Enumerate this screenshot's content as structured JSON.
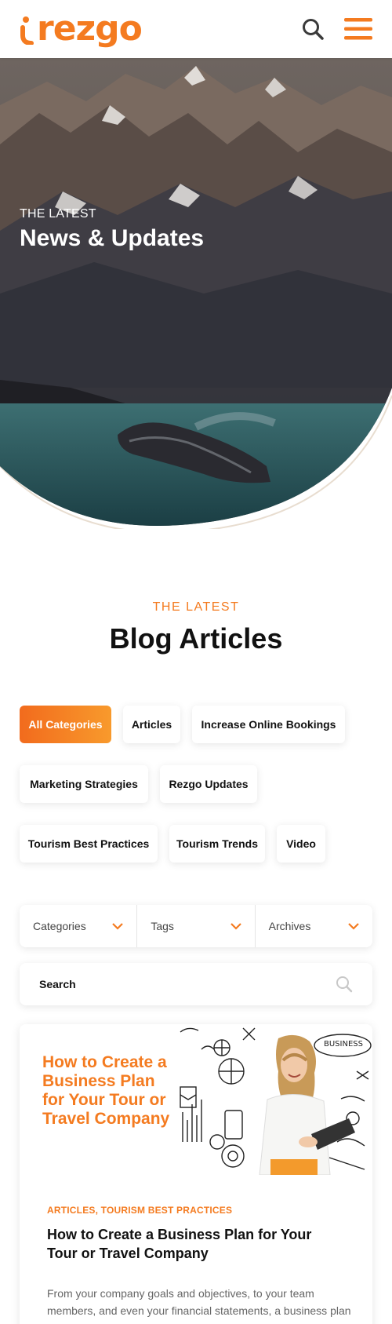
{
  "brand": {
    "name": "rezgo",
    "accent": "#f47b20"
  },
  "header": {
    "icons": [
      "search-icon",
      "hamburger-menu-icon"
    ]
  },
  "hero": {
    "eyebrow": "THE LATEST",
    "title": "News & Updates"
  },
  "blog": {
    "eyebrow": "THE LATEST",
    "title": "Blog Articles"
  },
  "categories": [
    {
      "label": "All Categories",
      "active": true
    },
    {
      "label": "Articles",
      "active": false
    },
    {
      "label": "Increase Online Bookings",
      "active": false
    },
    {
      "label": "Marketing Strategies",
      "active": false
    },
    {
      "label": "Rezgo Updates",
      "active": false
    },
    {
      "label": "Tourism Best Practices",
      "active": false
    },
    {
      "label": "Tourism Trends",
      "active": false
    },
    {
      "label": "Video",
      "active": false
    }
  ],
  "filters": [
    {
      "label": "Categories"
    },
    {
      "label": "Tags"
    },
    {
      "label": "Archives"
    }
  ],
  "search": {
    "placeholder": "Search"
  },
  "article": {
    "image_title": "How to Create a Business Plan for Your Tour or Travel Company",
    "image_badge": "BUSINESS",
    "categories": "ARTICLES, TOURISM BEST PRACTICES",
    "title": "How to Create a Business Plan for Your Tour or Travel Company",
    "excerpt": "From your company goals and objectives, to your team members, and even your financial statements, a business plan is an effective tool for analysing the"
  }
}
